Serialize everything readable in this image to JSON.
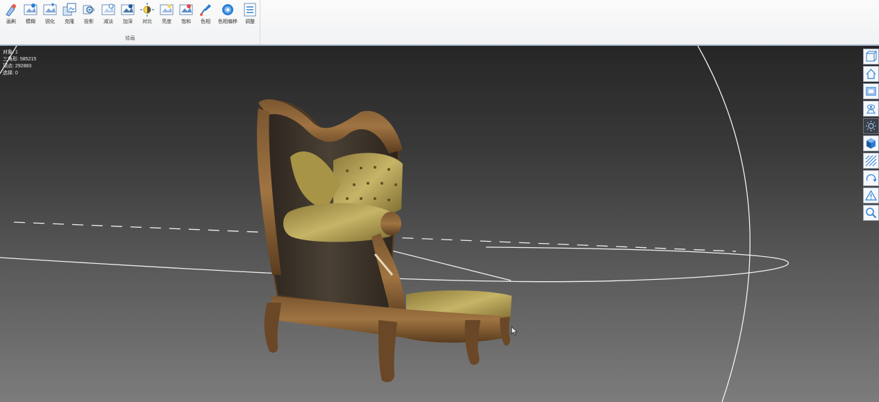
{
  "toolbar": {
    "tools": [
      {
        "label": "画刷",
        "icon": "brush-icon"
      },
      {
        "label": "模糊",
        "icon": "blur-icon"
      },
      {
        "label": "锐化",
        "icon": "sharpen-icon"
      },
      {
        "label": "克隆",
        "icon": "clone-icon"
      },
      {
        "label": "投影",
        "icon": "projection-icon"
      },
      {
        "label": "减淡",
        "icon": "dodge-icon"
      },
      {
        "label": "加深",
        "icon": "burn-icon"
      },
      {
        "label": "对比",
        "icon": "contrast-icon"
      },
      {
        "label": "亮度",
        "icon": "brightness-icon"
      },
      {
        "label": "饱和",
        "icon": "saturation-icon"
      },
      {
        "label": "色相",
        "icon": "hue-icon"
      },
      {
        "label": "色相偏移",
        "icon": "hue-shift-icon"
      },
      {
        "label": "调整",
        "icon": "adjust-icon"
      }
    ],
    "group_label": "绘画"
  },
  "stats": {
    "objects": "对象: 1",
    "triangles": "三角形: 585215",
    "vertices": "顶点: 292883",
    "selected": "选择: 0"
  },
  "side_tools": [
    {
      "name": "perspective-view-icon"
    },
    {
      "name": "home-view-icon"
    },
    {
      "name": "frame-view-icon"
    },
    {
      "name": "camera-view-icon"
    },
    {
      "name": "light-icon"
    },
    {
      "name": "shaded-cube-icon"
    },
    {
      "name": "wireframe-hatch-icon"
    },
    {
      "name": "orbit-icon"
    },
    {
      "name": "warning-icon"
    },
    {
      "name": "zoom-icon"
    }
  ],
  "colors": {
    "accent": "#2a7fd4",
    "ribbon_bg": "#f3f4f6",
    "viewport_top": "#262626",
    "viewport_bottom": "#7c7c7c"
  }
}
